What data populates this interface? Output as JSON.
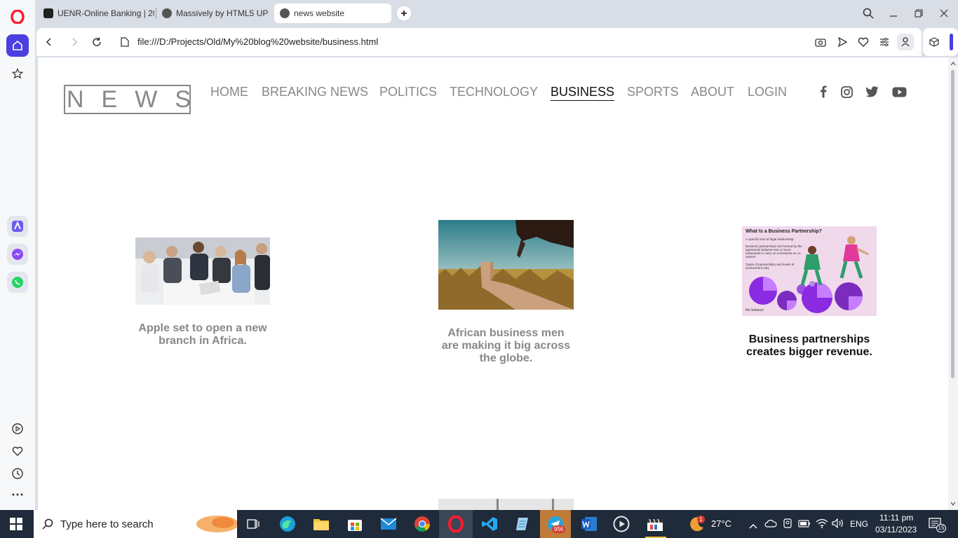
{
  "browser": {
    "tabs": [
      {
        "label": "UENR-Online Banking | 20"
      },
      {
        "label": "Massively by HTML5 UP"
      },
      {
        "label": "news website"
      }
    ],
    "url": "file:///D:/Projects/Old/My%20blog%20website/business.html"
  },
  "site": {
    "logo": "NEWS",
    "nav": [
      {
        "label": "HOME"
      },
      {
        "label": "BREAKING NEWS"
      },
      {
        "label": "POLITICS"
      },
      {
        "label": "TECHNOLOGY"
      },
      {
        "label": "BUSINESS",
        "active": true
      },
      {
        "label": "SPORTS"
      },
      {
        "label": "ABOUT"
      },
      {
        "label": "LOGIN"
      }
    ],
    "social_icons": [
      "facebook-icon",
      "instagram-icon",
      "twitter-icon",
      "youtube-icon"
    ],
    "articles": [
      {
        "title": "Apple set to open a new branch in Africa."
      },
      {
        "title": "African business men are making it big across the globe."
      },
      {
        "title": "Business partnerships creates bigger revenue."
      }
    ],
    "infographic": {
      "heading": "What Is a Business Partnership?",
      "bullets": [
        "A specific kind of legal relationship",
        "Business partnerships are formed by the agreement between two or more individuals to carry on a business as co-owners",
        "Types of partnerships and levels of involvement vary"
      ],
      "brand": "the balance"
    }
  },
  "taskbar": {
    "search_placeholder": "Type here to search",
    "temperature": "27°C",
    "language": "ENG",
    "time": "11:11 pm",
    "date": "03/11/2023",
    "telegram_badge": "956",
    "notification_count": "15",
    "weather_badge": "1"
  },
  "colors": {
    "opera_red": "#ff1b2d",
    "sidebar_active": "#4a3fe0",
    "menu_inactive": "#888888",
    "taskbar": "#1f2a3a"
  }
}
